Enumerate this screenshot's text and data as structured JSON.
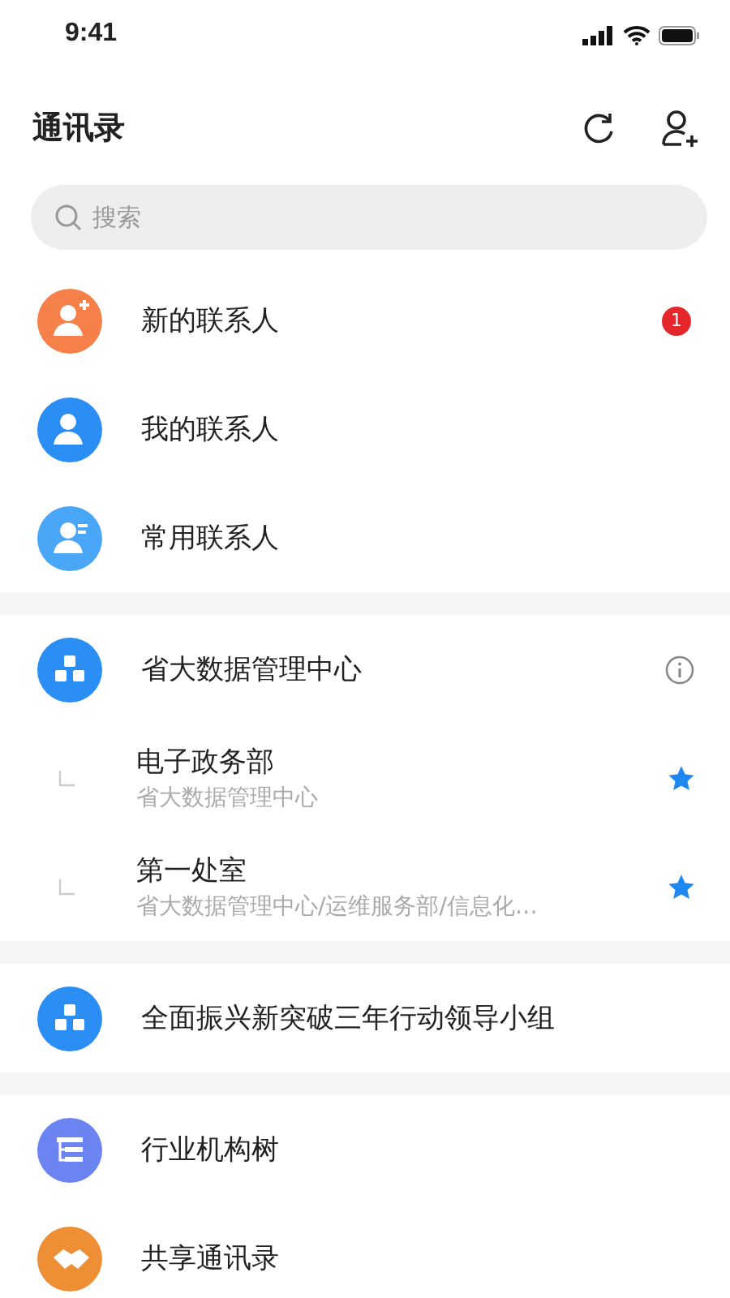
{
  "status_bar": {
    "time": "9:41"
  },
  "header": {
    "title": "通讯录"
  },
  "search": {
    "placeholder": "搜索"
  },
  "quick_items": [
    {
      "label": "新的联系人",
      "kind": "new",
      "color": "#f5804a",
      "badge": "1"
    },
    {
      "label": "我的联系人",
      "kind": "mine",
      "color": "#2b8ef5"
    },
    {
      "label": "常用联系人",
      "kind": "frequent",
      "color": "#4aa6f7"
    }
  ],
  "organization": {
    "name": "省大数据管理中心",
    "color": "#2b8ef5",
    "children": [
      {
        "name": "电子政务部",
        "path": "省大数据管理中心",
        "starred": true
      },
      {
        "name": "第一处室",
        "path": "省大数据管理中心/运维服务部/信息化…",
        "starred": true
      }
    ]
  },
  "group": {
    "name": "全面振兴新突破三年行动领导小组",
    "color": "#2b8ef5"
  },
  "more_items": [
    {
      "label": "行业机构树",
      "kind": "tree",
      "color": "#6c84f2"
    },
    {
      "label": "共享通讯录",
      "kind": "share",
      "color": "#ee8f35"
    }
  ]
}
